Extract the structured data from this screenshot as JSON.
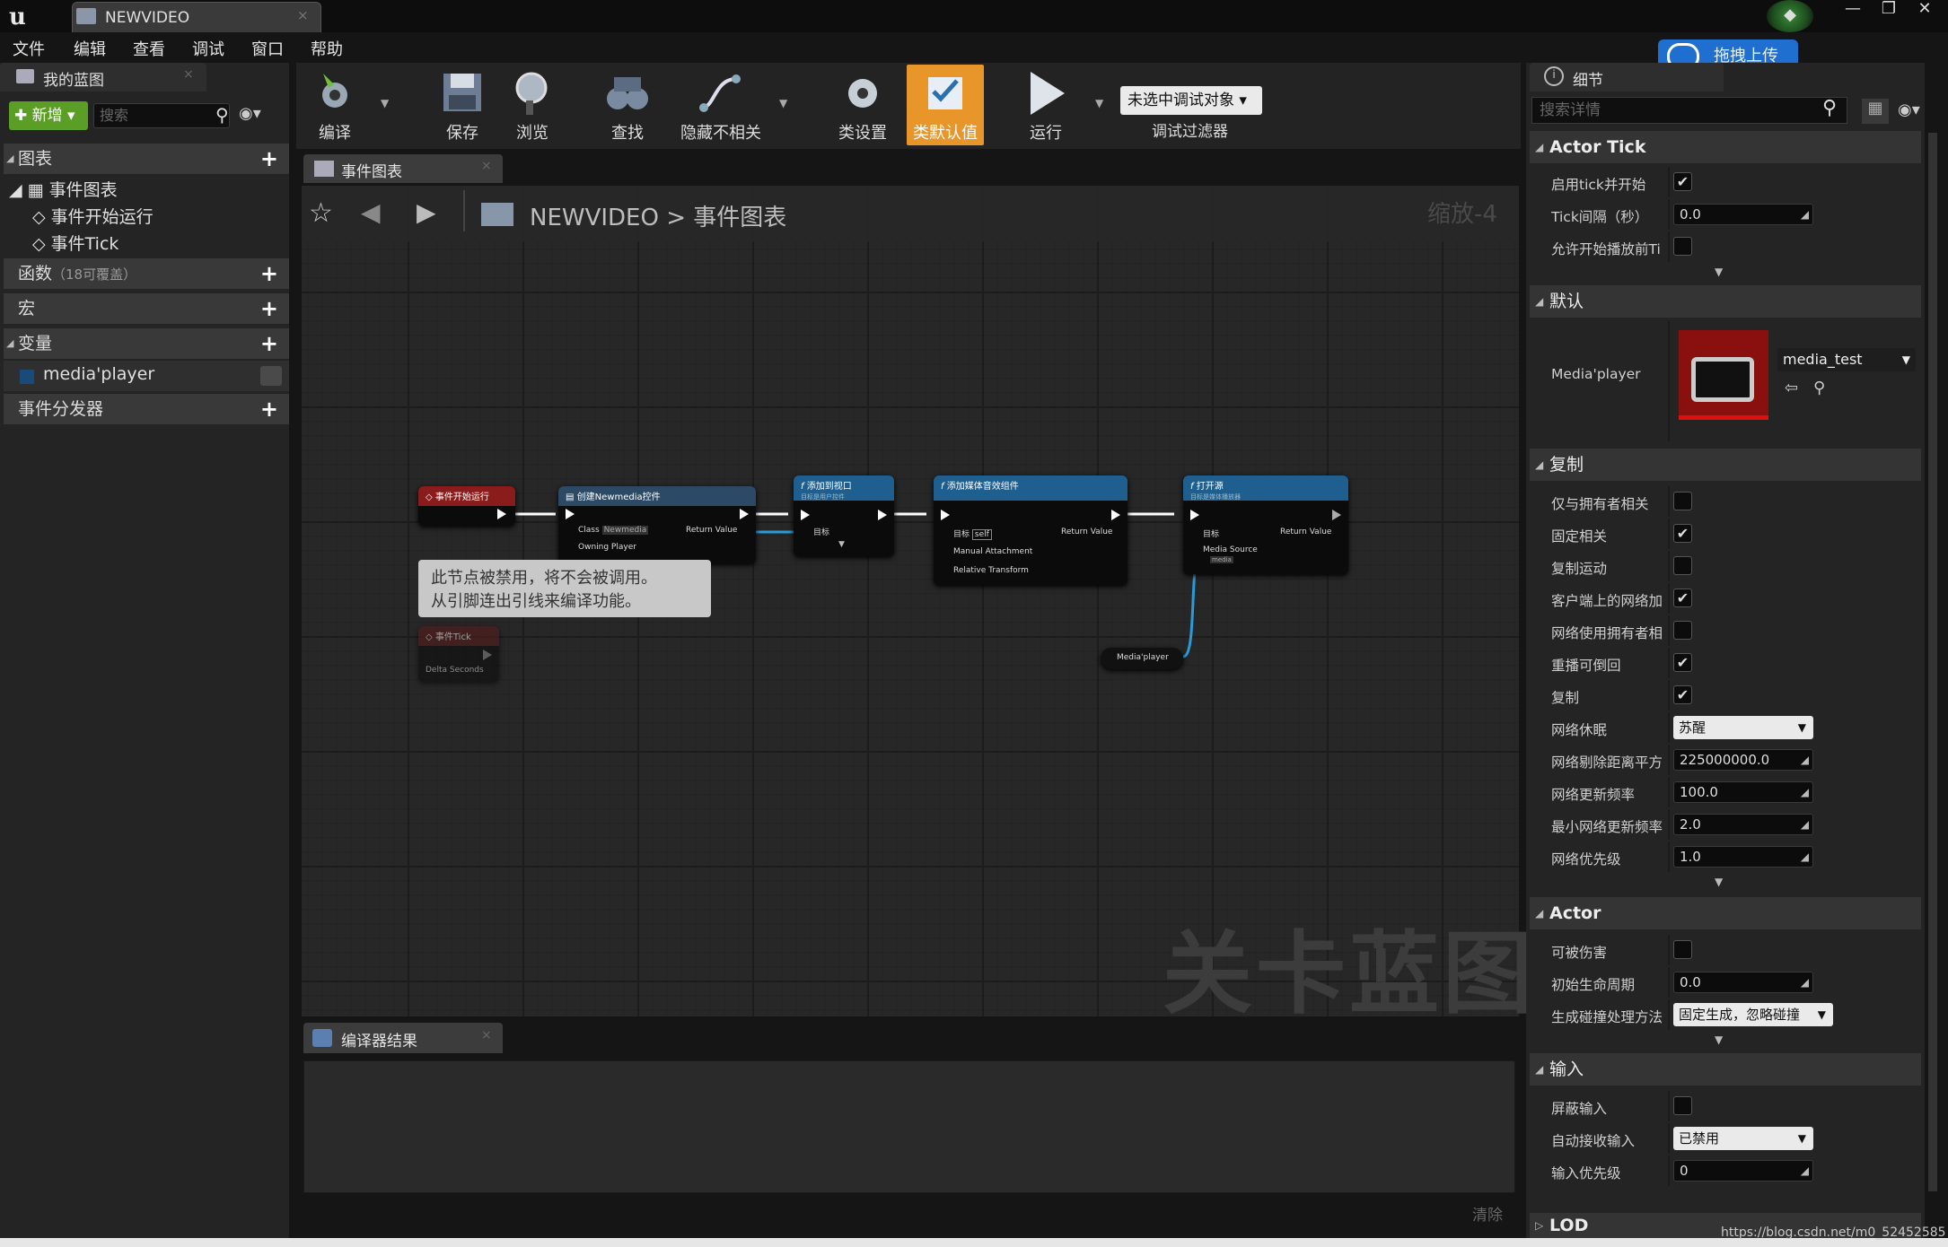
{
  "window": {
    "app_glyph": "u",
    "tab_title": "NEWVIDEO",
    "tab_close": "×",
    "min": "—",
    "max": "❐",
    "close": "✕"
  },
  "menu": [
    "文件",
    "编辑",
    "查看",
    "调试",
    "窗口",
    "帮助"
  ],
  "upload_label": "拖拽上传",
  "left_panel": {
    "tab_title": "我的蓝图",
    "add_new": "新增",
    "search_placeholder": "搜索",
    "sections": {
      "graphs": "图表",
      "event_graph": "事件图表",
      "event_begin_play": "事件开始运行",
      "event_tick": "事件Tick",
      "functions": "函数",
      "functions_hint": "（18可覆盖）",
      "macros": "宏",
      "variables": "变量",
      "var_media_player": "media'player",
      "dispatchers": "事件分发器"
    }
  },
  "toolbar": {
    "compile": "编译",
    "save": "保存",
    "browse": "浏览",
    "find": "查找",
    "hide_unrelated": "隐藏不相关",
    "class_settings": "类设置",
    "class_defaults": "类默认值",
    "run": "运行",
    "debug_object": "未选中调试对象",
    "debug_filter": "调试过滤器"
  },
  "graph": {
    "tab_title": "事件图表",
    "breadcrumb_root": "NEWVIDEO",
    "breadcrumb_sep": ">",
    "breadcrumb_leaf": "事件图表",
    "zoom": "缩放-4",
    "watermark": "关卡蓝图",
    "nodes": {
      "begin_play": "事件开始运行",
      "create_widget": "创建Newmedia控件",
      "create_class_label": "Class",
      "create_class_value": "Newmedia",
      "create_owning_player": "Owning Player",
      "create_return": "Return Value",
      "add_viewport": "添加到视口",
      "add_viewport_sub": "目标是用户控件",
      "add_viewport_target": "目标",
      "add_media_sound": "添加媒体音效组件",
      "add_media_target": "目标",
      "add_media_self": "self",
      "add_media_manual": "Manual Attachment",
      "add_media_transform": "Relative Transform",
      "add_media_return": "Return Value",
      "open_source": "打开源",
      "open_source_sub": "目标是媒体播放器",
      "open_target": "目标",
      "open_media_source": "Media Source",
      "open_media_value": "media",
      "open_return": "Return Value",
      "media_player_var": "Media'player",
      "event_tick": "事件Tick",
      "delta_seconds": "Delta Seconds",
      "disabled_note_line1": "此节点被禁用，将不会被调用。",
      "disabled_note_line2": "从引脚连出引线来编译功能。"
    }
  },
  "compiler": {
    "tab_title": "编译器结果",
    "clear": "清除"
  },
  "details": {
    "tab_title": "细节",
    "search_placeholder": "搜索详情",
    "actor_tick": {
      "title": "Actor Tick",
      "start_with_tick": "启用tick并开始",
      "tick_interval": "Tick间隔（秒）",
      "tick_interval_value": "0.0",
      "allow_before_begin": "允许开始播放前Ti"
    },
    "default": {
      "title": "默认",
      "media_player": "Media'player",
      "asset": "media_test"
    },
    "replication": {
      "title": "复制",
      "only_relevant_owner": "仅与拥有者相关",
      "always_relevant": "固定相关",
      "replicate_movement": "复制运动",
      "net_load_client": "客户端上的网络加",
      "net_use_owner": "网络使用拥有者相",
      "replay_rewindable": "重播可倒回",
      "replicates": "复制",
      "net_dormancy": "网络休眠",
      "net_dormancy_value": "苏醒",
      "net_cull_dist": "网络剔除距离平方",
      "net_cull_dist_value": "225000000.0",
      "net_update_freq": "网络更新频率",
      "net_update_freq_value": "100.0",
      "min_net_update_freq": "最小网络更新频率",
      "min_net_update_freq_value": "2.0",
      "net_priority": "网络优先级",
      "net_priority_value": "1.0"
    },
    "actor": {
      "title": "Actor",
      "can_be_damaged": "可被伤害",
      "initial_life_span": "初始生命周期",
      "initial_life_span_value": "0.0",
      "spawn_collision": "生成碰撞处理方法",
      "spawn_collision_value": "固定生成，忽略碰撞"
    },
    "input": {
      "title": "输入",
      "block_input": "屏蔽输入",
      "auto_receive": "自动接收输入",
      "auto_receive_value": "已禁用",
      "input_priority": "输入优先级",
      "input_priority_value": "0"
    },
    "lod": {
      "title": "LOD"
    },
    "checkbox_states": {
      "start_with_tick": true,
      "allow_before_begin": false,
      "only_relevant_owner": false,
      "always_relevant": true,
      "replicate_movement": false,
      "net_load_client": true,
      "net_use_owner": false,
      "replay_rewindable": true,
      "replicates": true,
      "can_be_damaged": false,
      "block_input": false
    }
  },
  "watermark_url": "https://blog.csdn.net/m0_52452585",
  "colors": {
    "accent_orange": "#e8962a",
    "add_green": "#5b9e26",
    "upload_blue": "#1e6fd0",
    "event_red": "#8a1c1c",
    "func_blue": "#1f5f8f",
    "pin_blue": "#2b9bd8"
  }
}
